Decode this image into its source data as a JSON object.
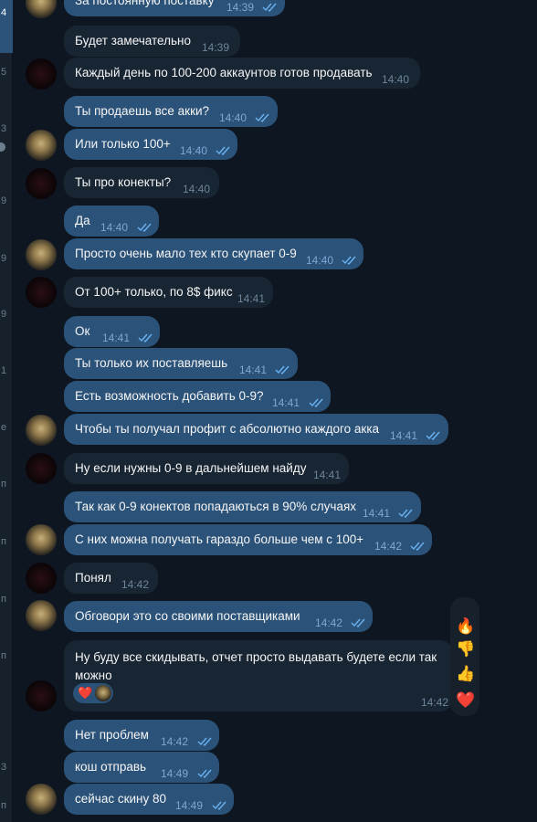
{
  "sidebar": {
    "fragments": [
      "4",
      "5",
      "3",
      "9",
      "9",
      "9",
      "1",
      "е",
      "п",
      "п",
      "п",
      "п",
      "3",
      "п"
    ]
  },
  "messages": [
    {
      "text": "За постоянную поставку",
      "time": "14:39"
    },
    {
      "text": "Будет замечательно",
      "time": "14:39"
    },
    {
      "text": "Каждый день по 100-200 аккаунтов готов продавать",
      "time": "14:40"
    },
    {
      "text": "Ты продаешь все акки?",
      "time": "14:40"
    },
    {
      "text": "Или только 100+",
      "time": "14:40"
    },
    {
      "text": "Ты про конекты?",
      "time": "14:40"
    },
    {
      "text": "Да",
      "time": "14:40"
    },
    {
      "text": "Просто очень мало тех кто скупает 0-9",
      "time": "14:40"
    },
    {
      "text": "От 100+ только, по 8$ фикс",
      "time": "14:41"
    },
    {
      "text": "Ок",
      "time": "14:41"
    },
    {
      "text": "Ты только их поставляешь",
      "time": "14:41"
    },
    {
      "text": "Есть возможность добавить 0-9?",
      "time": "14:41"
    },
    {
      "text": "Чтобы ты получал профит с абсолютно каждого акка",
      "time": "14:41"
    },
    {
      "text": "Ну если нужны 0-9 в дальнейшем найду",
      "time": "14:41"
    },
    {
      "text": "Так как 0-9 конектов попадаються в 90% случаях",
      "time": "14:41"
    },
    {
      "text": "С них можна получать гараздо больше чем с 100+",
      "time": "14:42"
    },
    {
      "text": "Понял",
      "time": "14:42"
    },
    {
      "text": "Обговори это со своими поставщиками",
      "time": "14:42"
    },
    {
      "text": "Ну буду все скидывать, отчет просто выдавать будете если так можно",
      "time": "14:42"
    },
    {
      "text": "Нет проблем",
      "time": "14:42"
    },
    {
      "text": "кош отправь",
      "time": "14:49"
    },
    {
      "text": "сейчас скину 80",
      "time": "14:49"
    }
  ],
  "reactions_menu": [
    "🔥",
    "👎",
    "👍",
    "❤️"
  ],
  "message_reaction": "❤️",
  "colors": {
    "background": "#0e1621",
    "incoming": "#182533",
    "outgoing": "#2b5278",
    "check": "#6ab3f3"
  }
}
